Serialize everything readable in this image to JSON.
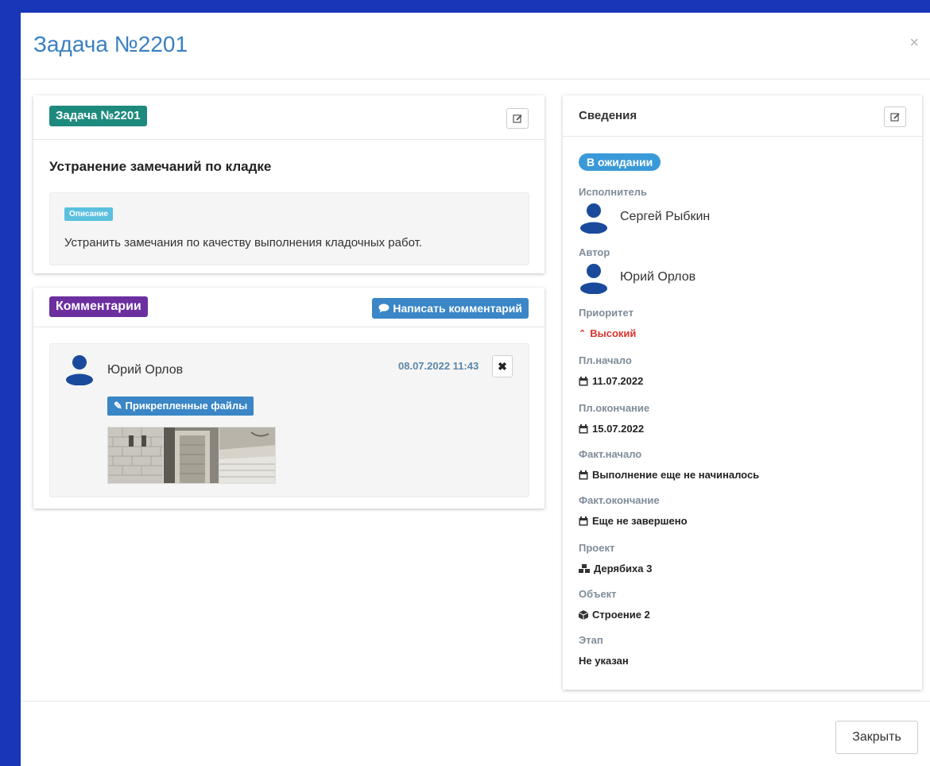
{
  "modal": {
    "title": "Задача №2201",
    "close_glyph": "×",
    "footer_close_label": "Закрыть"
  },
  "task": {
    "badge": "Задача №2201",
    "name": "Устранение замечаний по кладке",
    "description_tag": "Описание",
    "description": "Устранить замечания по качеству выполнения кладочных работ.",
    "badge_color": "#1e8a7e"
  },
  "comments": {
    "badge": "Комментарии",
    "write_button": "Написать комментарий",
    "badge_color": "#6b2fa0",
    "items": [
      {
        "author": "Юрий Орлов",
        "date": "08.07.2022 11:43",
        "delete_glyph": "✖",
        "files_tag": "Прикрепленные файлы",
        "attachments": [
          "photo-brick-wall",
          "photo-doorway",
          "photo-ceiling"
        ]
      }
    ]
  },
  "info": {
    "title": "Сведения",
    "status": "В ожидании",
    "executor_label": "Исполнитель",
    "executor": "Сергей Рыбкин",
    "author_label": "Автор",
    "author": "Юрий Орлов",
    "priority_label": "Приоритет",
    "priority": "Высокий",
    "plan_start_label": "Пл.начало",
    "plan_start": "11.07.2022",
    "plan_end_label": "Пл.окончание",
    "plan_end": "15.07.2022",
    "fact_start_label": "Факт.начало",
    "fact_start": "Выполнение еще не начиналось",
    "fact_end_label": "Факт.окончание",
    "fact_end": "Еще не завершено",
    "project_label": "Проект",
    "project": "Дерябиха 3",
    "object_label": "Объект",
    "object": "Строение 2",
    "stage_label": "Этап",
    "stage": "Не указан",
    "status_color": "#3a9ad9",
    "priority_color": "#d9352e"
  },
  "colors": {
    "backdrop": "#1a36b8",
    "title": "#3a7fc1",
    "primary_button": "#3a86c6",
    "avatar": "#1a4a9c"
  }
}
